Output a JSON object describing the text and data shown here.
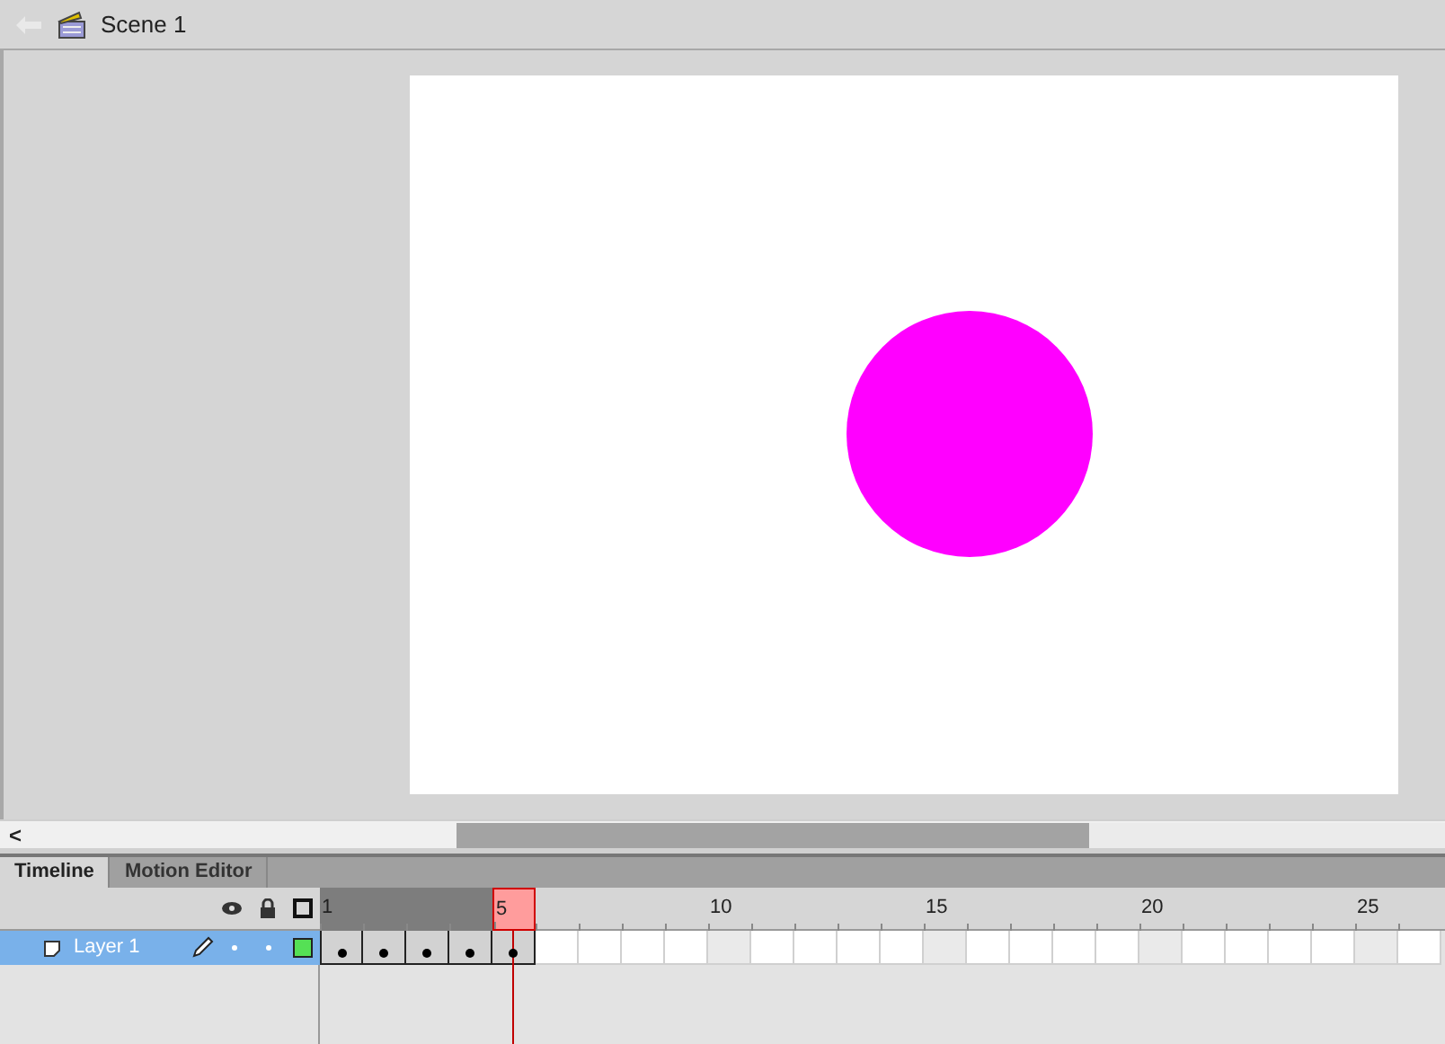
{
  "breadcrumb": {
    "scene": "Scene 1"
  },
  "stage": {
    "shape": {
      "kind": "circle",
      "color": "#ff00ff"
    }
  },
  "scrollbar": {
    "arrow": "<",
    "level": 0.64
  },
  "tabs": [
    {
      "label": "Timeline",
      "selected": true
    },
    {
      "label": "Motion Editor",
      "selected": false
    }
  ],
  "ruler_labels": [
    "1",
    "5",
    "10",
    "15",
    "20",
    "25"
  ],
  "layers": [
    {
      "name": "Layer 1",
      "selected": true,
      "color": "#55e055"
    }
  ],
  "frames": [
    {
      "kind": "keyframe",
      "selected": true,
      "current": false
    },
    {
      "kind": "keyframe",
      "selected": true,
      "current": false
    },
    {
      "kind": "keyframe",
      "selected": true,
      "current": false
    },
    {
      "kind": "keyframe",
      "selected": true,
      "current": false
    },
    {
      "kind": "keyframe",
      "selected": true,
      "current": true
    },
    {
      "kind": "empty",
      "selected": false,
      "current": false
    },
    {
      "kind": "empty",
      "selected": false,
      "current": false
    },
    {
      "kind": "empty",
      "selected": false,
      "current": false
    },
    {
      "kind": "empty",
      "selected": false,
      "current": false
    },
    {
      "kind": "empty",
      "selected": false,
      "current": false
    },
    {
      "kind": "empty",
      "selected": false,
      "current": false
    },
    {
      "kind": "empty",
      "selected": false,
      "current": false
    },
    {
      "kind": "empty",
      "selected": false,
      "current": false
    },
    {
      "kind": "empty",
      "selected": false,
      "current": false
    },
    {
      "kind": "empty",
      "selected": false,
      "current": false
    },
    {
      "kind": "empty",
      "selected": false,
      "current": false
    },
    {
      "kind": "empty",
      "selected": false,
      "current": false
    },
    {
      "kind": "empty",
      "selected": false,
      "current": false
    },
    {
      "kind": "empty",
      "selected": false,
      "current": false
    },
    {
      "kind": "empty",
      "selected": false,
      "current": false
    },
    {
      "kind": "empty",
      "selected": false,
      "current": false
    },
    {
      "kind": "empty",
      "selected": false,
      "current": false
    },
    {
      "kind": "empty",
      "selected": false,
      "current": false
    },
    {
      "kind": "empty",
      "selected": false,
      "current": false
    },
    {
      "kind": "empty",
      "selected": false,
      "current": false
    },
    {
      "kind": "empty",
      "selected": false,
      "current": false
    }
  ]
}
